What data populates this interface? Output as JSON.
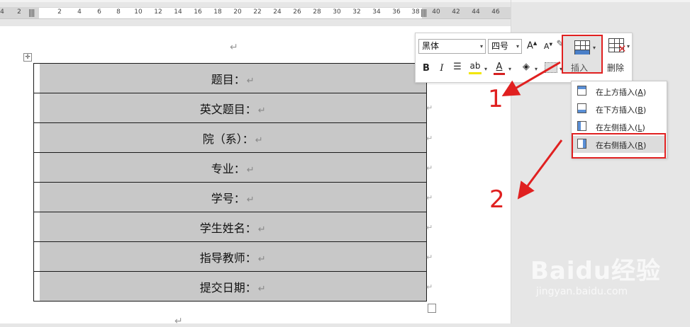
{
  "ruler": {
    "ticks": [
      "4",
      "2",
      "2",
      "4",
      "6",
      "8",
      "10",
      "12",
      "14",
      "16",
      "18",
      "20",
      "22",
      "24",
      "26",
      "28",
      "30",
      "32",
      "34",
      "36",
      "38",
      "40",
      "42",
      "44",
      "46"
    ]
  },
  "document": {
    "rows": [
      {
        "label": "题目："
      },
      {
        "label": "英文题目："
      },
      {
        "label": "院（系）："
      },
      {
        "label": "专业："
      },
      {
        "label": "学号："
      },
      {
        "label": "学生姓名："
      },
      {
        "label": "指导教师："
      },
      {
        "label": "提交日期："
      }
    ],
    "para_mark": "↵",
    "row_end_mark": "↵"
  },
  "minibar": {
    "font_name": "黑体",
    "font_size": "四号",
    "grow_font": "A",
    "shrink_font": "A",
    "bold": "B",
    "italic": "I",
    "insert_label": "插入",
    "delete_label": "删除",
    "highlight_color": "#f2e600",
    "font_color": "#d62020"
  },
  "insert_menu": {
    "items": [
      {
        "label": "在上方插入",
        "key": "A"
      },
      {
        "label": "在下方插入",
        "key": "B"
      },
      {
        "label": "在左侧插入",
        "key": "L"
      },
      {
        "label": "在右侧插入",
        "key": "R"
      }
    ]
  },
  "annotations": {
    "step1": "1",
    "step2": "2"
  },
  "watermark": {
    "logo": "Baidu经验",
    "url": "jingyan.baidu.com"
  }
}
